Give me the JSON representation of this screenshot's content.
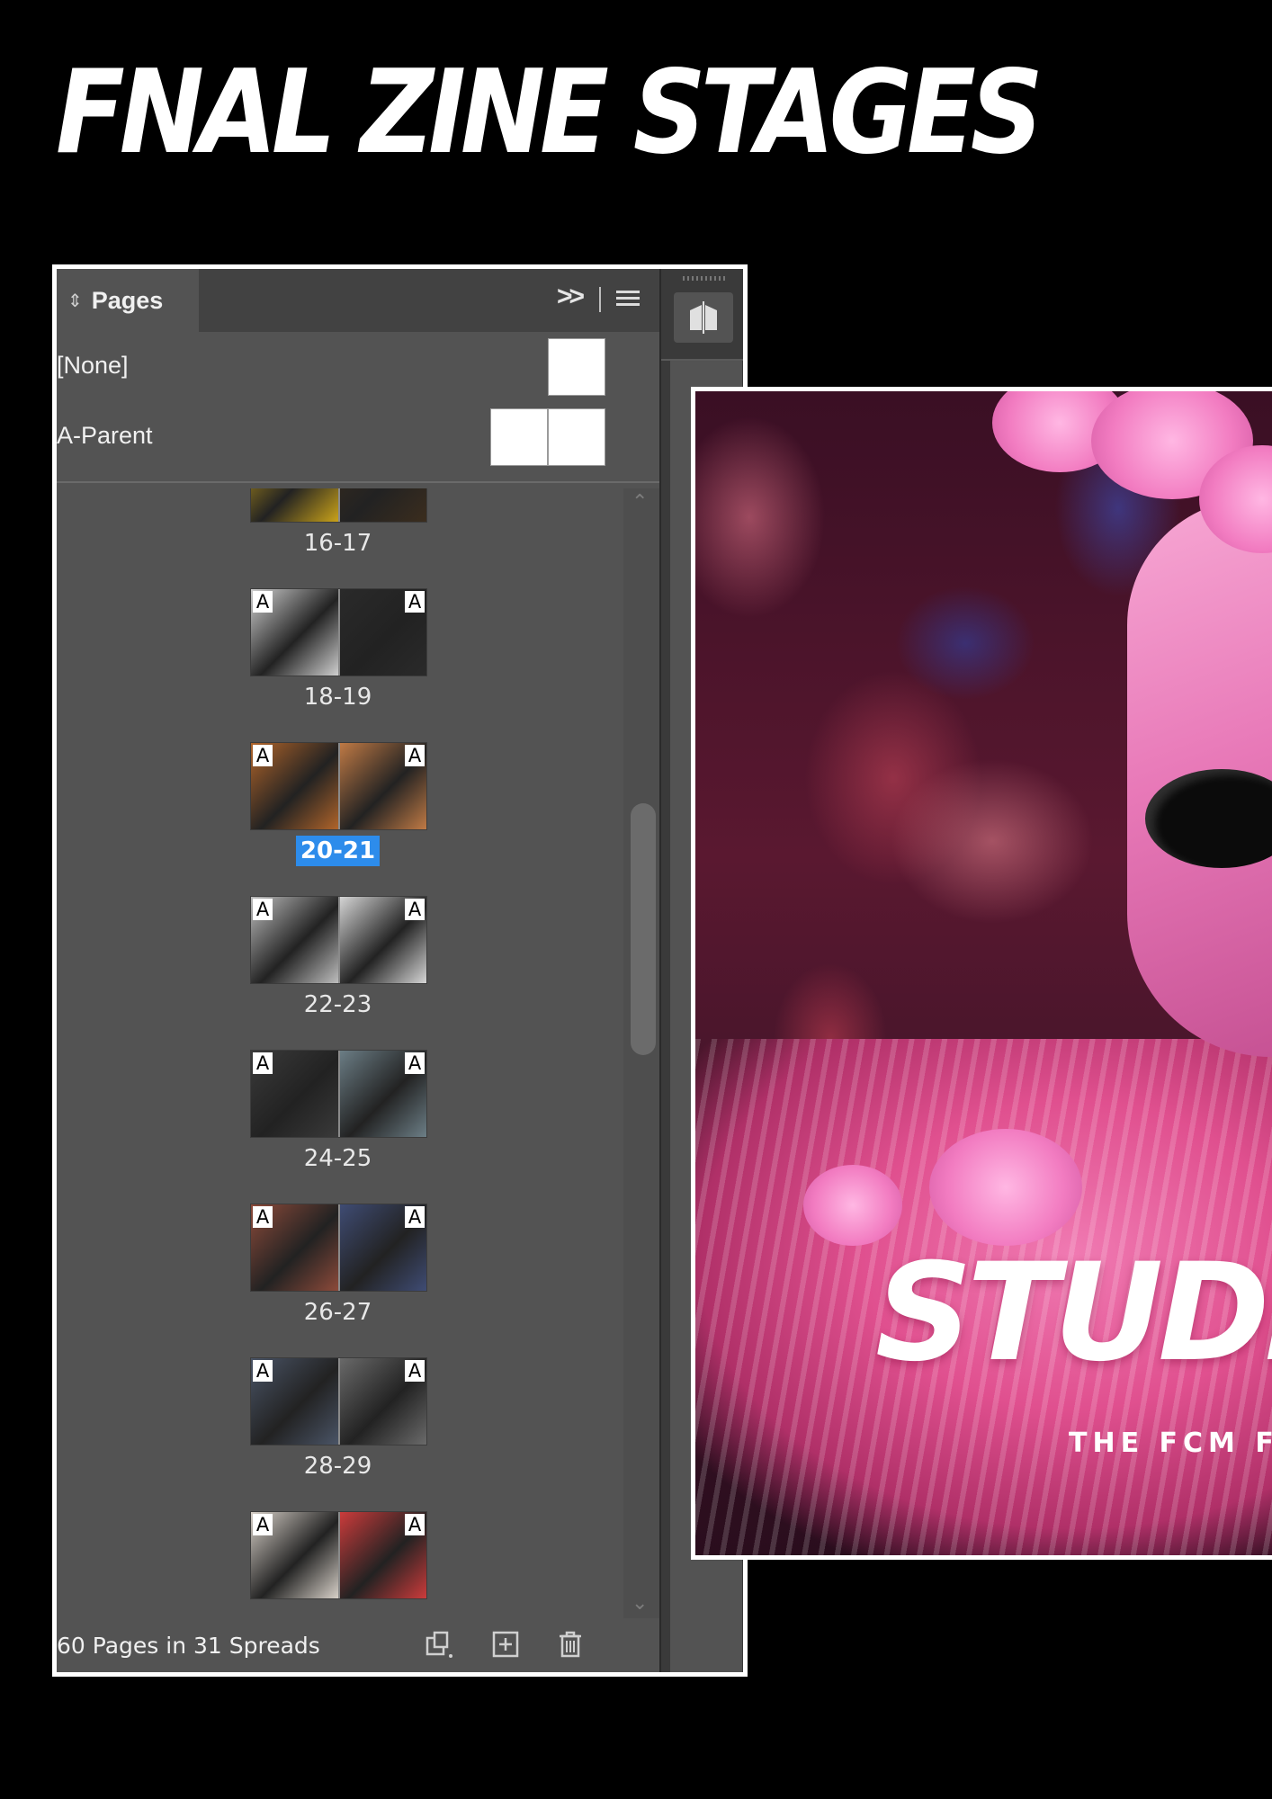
{
  "heading": "FNAL ZINE STAGES",
  "panel": {
    "tab_label": "Pages",
    "expand_glyph": ">>",
    "parents": [
      {
        "label": "[None]",
        "pages": 1
      },
      {
        "label": "A-Parent",
        "pages": 2
      }
    ],
    "spreads": [
      {
        "label": "16-17",
        "selected": false,
        "parent_marks": false,
        "colors": [
          "#c9a21a",
          "#3b2d1e"
        ]
      },
      {
        "label": "18-19",
        "selected": false,
        "parent_marks": true,
        "colors": [
          "#cfcfcf",
          "#2a2a2a"
        ]
      },
      {
        "label": "20-21",
        "selected": true,
        "parent_marks": true,
        "colors": [
          "#b0642a",
          "#c07a45"
        ]
      },
      {
        "label": "22-23",
        "selected": false,
        "parent_marks": true,
        "colors": [
          "#bdbdbd",
          "#d6d6d6"
        ]
      },
      {
        "label": "24-25",
        "selected": false,
        "parent_marks": true,
        "colors": [
          "#3a3a3a",
          "#6c7e86"
        ]
      },
      {
        "label": "26-27",
        "selected": false,
        "parent_marks": true,
        "colors": [
          "#8c4a3a",
          "#3f4c74"
        ]
      },
      {
        "label": "28-29",
        "selected": false,
        "parent_marks": true,
        "colors": [
          "#4a5466",
          "#6a6a6a"
        ]
      },
      {
        "label": "",
        "selected": false,
        "parent_marks": true,
        "colors": [
          "#d7d0c8",
          "#cc3b3b"
        ]
      }
    ],
    "status_text": "60 Pages in 31 Spreads",
    "footer_icons": [
      "edit-page-size-icon",
      "new-page-icon",
      "delete-page-icon"
    ]
  },
  "cover": {
    "brand_text": "STUDI",
    "tagline": "THE FCM FA"
  }
}
